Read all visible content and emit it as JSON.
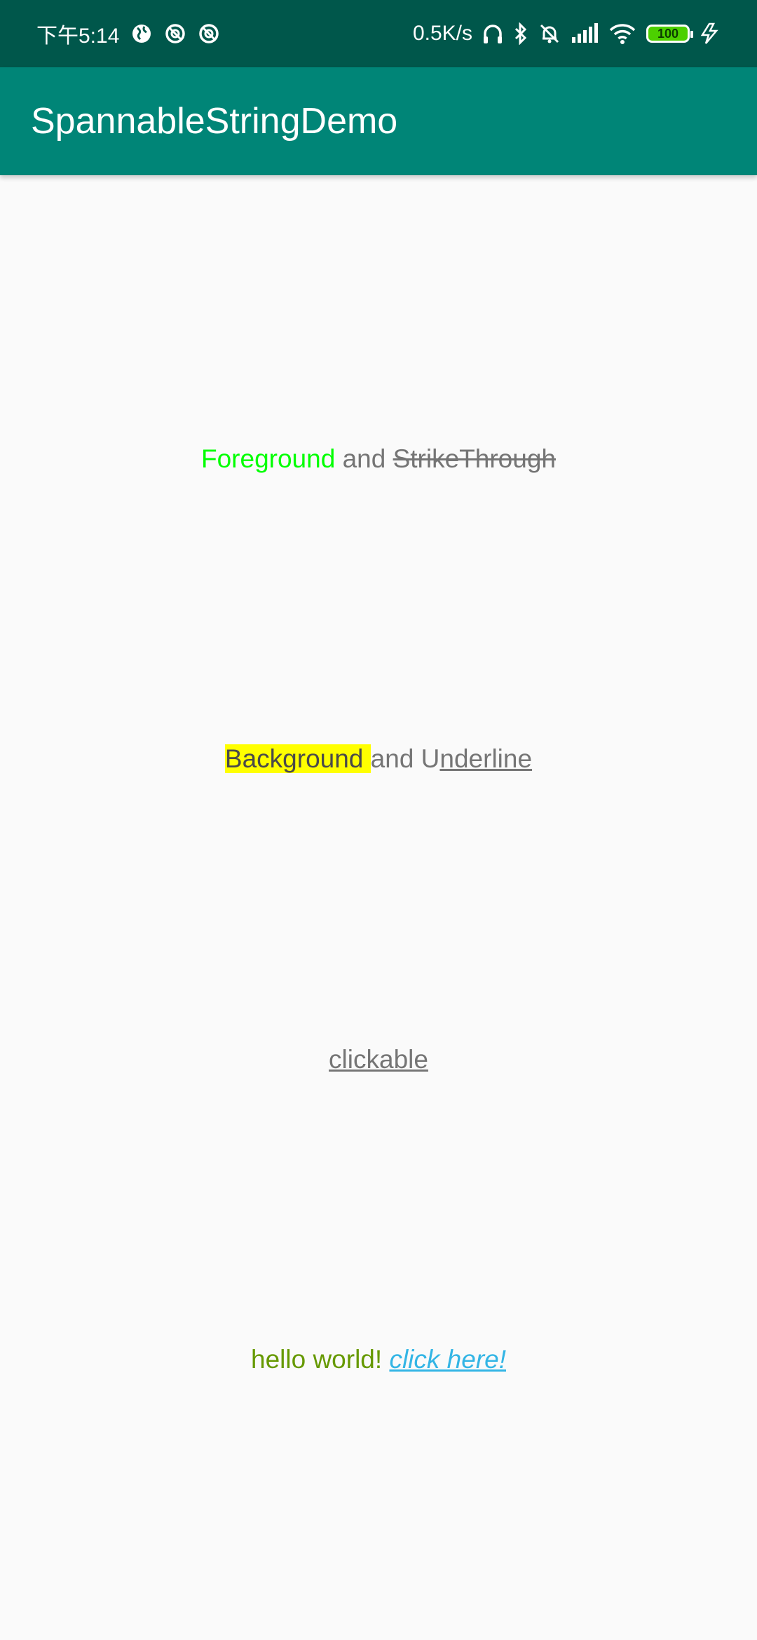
{
  "status_bar": {
    "time": "下午5:14",
    "net_speed": "0.5K/s",
    "battery": "100"
  },
  "app_bar": {
    "title": "SpannableStringDemo"
  },
  "lines": [
    {
      "fg": "Foreground",
      "mid": " and ",
      "strike": "StrikeThrough"
    },
    {
      "bg": "Background ",
      "mid": "and U",
      "ul": "nderline"
    },
    {
      "click": "clickable"
    },
    {
      "hello": "hello world! ",
      "link": "click here!"
    }
  ]
}
